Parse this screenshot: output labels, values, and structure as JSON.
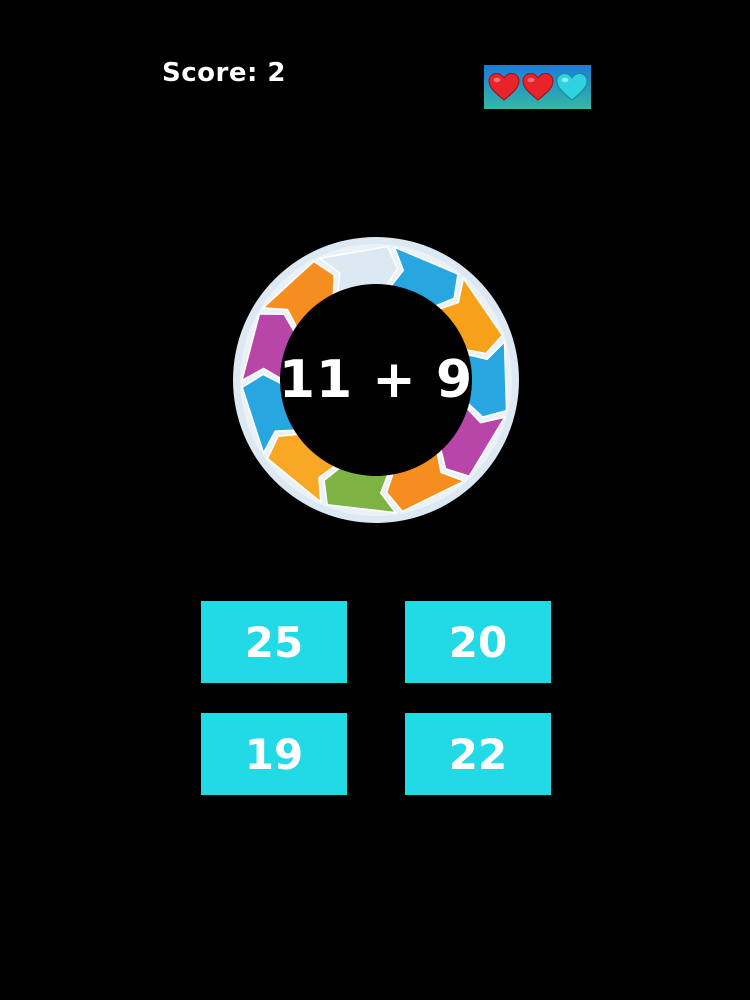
{
  "hud": {
    "score_text": "Score: 2",
    "lives": [
      "heart-full",
      "heart-full",
      "heart-empty"
    ]
  },
  "problem": {
    "expression": "11 + 9"
  },
  "answers": [
    {
      "label": "25"
    },
    {
      "label": "20"
    },
    {
      "label": "19"
    },
    {
      "label": "22"
    }
  ],
  "colors": {
    "background": "#000000",
    "answer_button": "#22d9e6",
    "heart_full": "#e8242a",
    "heart_empty": "#2fd3e0",
    "wheel_segments": [
      "#27a6e0",
      "#f7a11a",
      "#27a6e0",
      "#b846a8",
      "#f58d1f",
      "#7cb342",
      "#f9a825",
      "#27a6e0",
      "#b846a8",
      "#f58d1f",
      "#dde9f2"
    ]
  }
}
